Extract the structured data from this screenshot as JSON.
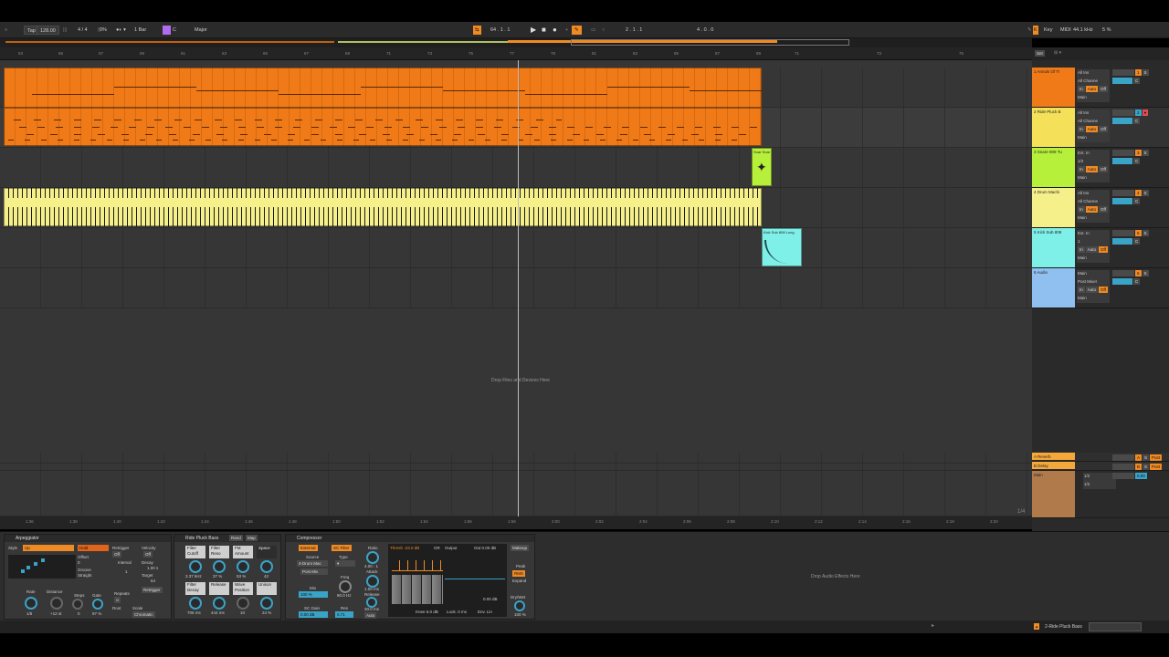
{
  "transport": {
    "tap": "Tap",
    "tempo": "128.00",
    "meter": "4 / 4",
    "swing": "0%",
    "quant": "1 Bar",
    "key": "C",
    "scale": "Major",
    "position": "64 . 1 . 1",
    "loop_start": "2 . 1 . 1",
    "loop_len": "4 . 0 . 0",
    "key_btn": "Key",
    "midi_btn": "MIDI",
    "sample_rate": "44.1 kHz",
    "cpu": "5 %"
  },
  "ruler_bars": [
    "53",
    "55",
    "57",
    "59",
    "61",
    "63",
    "65",
    "67",
    "69",
    "71",
    "73",
    "75",
    "77",
    "79",
    "81",
    "83",
    "85",
    "87",
    "89",
    "71",
    "73",
    "75"
  ],
  "timeline_ticks": [
    "1:36",
    "1:38",
    "1:40",
    "1:42",
    "1:44",
    "1:46",
    "1:48",
    "1:50",
    "1:52",
    "1:54",
    "1:56",
    "1:58",
    "2:00",
    "2:02",
    "2:04",
    "2:06",
    "2:08",
    "2:10",
    "2:12",
    "2:14",
    "2:16",
    "2:18",
    "2:20"
  ],
  "clips": {
    "snare_label": "Snar Snar",
    "kick_label": "Kick Sub 808 Long"
  },
  "arrangement": {
    "drop_text": "Drop Files and Devices Here",
    "page_counter": "1/4"
  },
  "tracks": [
    {
      "name": "1 Annuls Of Ti",
      "in": "All Ins",
      "ch": "All Channe",
      "mon_in": "In",
      "mon_auto": "Auto",
      "mon_off": "Off",
      "out": "Main",
      "color": "#f07a18",
      "num": "1"
    },
    {
      "name": "2 Ride Pluck B",
      "in": "All Ins",
      "ch": "All Channe",
      "mon_in": "In",
      "mon_auto": "Auto",
      "mon_off": "Off",
      "out": "Main",
      "color": "#f5e05a",
      "num": "2"
    },
    {
      "name": "3 Snare 909 Tu",
      "in": "Ext. In",
      "ch": "1/2",
      "mon_in": "In",
      "mon_auto": "Auto",
      "mon_off": "Off",
      "out": "Main",
      "color": "#b7f03a",
      "num": "3"
    },
    {
      "name": "4 Drum Machi",
      "in": "All Ins",
      "ch": "All Channe",
      "mon_in": "In",
      "mon_auto": "Auto",
      "mon_off": "Off",
      "out": "Main",
      "color": "#f5f08a",
      "num": "4"
    },
    {
      "name": "5 Kick Sub 808",
      "in": "Ext. In",
      "ch": "1",
      "mon_in": "In",
      "mon_auto": "Auto",
      "mon_off": "Off",
      "out": "Main",
      "color": "#7ff0e8",
      "num": "5"
    },
    {
      "name": "6 Audio",
      "in": "Main",
      "ch": "Post Mixer",
      "mon_in": "In",
      "mon_auto": "Auto",
      "mon_off": "Off",
      "out": "Main",
      "color": "#8fc0f0",
      "num": "6"
    }
  ],
  "returns": [
    {
      "name": "A Reverb",
      "letter": "A"
    },
    {
      "name": "B Delay",
      "letter": "B"
    }
  ],
  "master": {
    "name": "Main",
    "out1": "1/2",
    "out2": "1/2",
    "vol": "0.00"
  },
  "mixer_header": {
    "set": "Set"
  },
  "arpeggiator": {
    "title": "Arpeggiator",
    "style_label": "Style",
    "style": "Up",
    "hold": "Hold",
    "offset_label": "Offset",
    "offset": "0",
    "groove_label": "Groove",
    "groove": "Straight",
    "retrig_label": "Retrigger",
    "retrig": "Off",
    "interval_label": "Interval",
    "interval": "1",
    "repeats_label": "Repeats",
    "repeats": "∞",
    "root_label": "Root",
    "scale_label": "Scale",
    "scale": "Chromatic",
    "velocity_label": "Velocity",
    "velocity": "Off",
    "decay_label": "Decay",
    "decay": "1.00 s",
    "target_label": "Target",
    "target": "64",
    "retrigger_btn": "Retrigger",
    "rate_label": "Rate",
    "rate": "1/8",
    "distance_label": "Distance",
    "distance": "+12 st",
    "steps_label": "Steps",
    "steps": "0",
    "gate_label": "Gate",
    "gate": "97 %"
  },
  "ride": {
    "title": "Ride Pluck Bass",
    "rand": "Rand",
    "map": "Map",
    "macros": [
      {
        "label": "Filter Cutoff",
        "val": "3.37 kHz"
      },
      {
        "label": "Filter Reso",
        "val": "37 %"
      },
      {
        "label": "FM Amount",
        "val": "53 %"
      },
      {
        "label": "Space",
        "val": "42"
      },
      {
        "label": "Filter Decay",
        "val": "706 ms"
      },
      {
        "label": "Release",
        "val": "444 ms"
      },
      {
        "label": "Wave Position",
        "val": "10"
      },
      {
        "label": "Unison",
        "val": "24 %"
      }
    ]
  },
  "compressor": {
    "title": "Compressor",
    "external": "External",
    "sc_filter": "SC Filter",
    "source_label": "Source",
    "source": "4-Drum Mac",
    "post_mix": "Post Mix",
    "type_label": "Type",
    "mix_label": "Mix",
    "mix": "100 %",
    "sc_gain_label": "SC Gain",
    "sc_gain": "0.00 dB",
    "freq_label": "Freq",
    "freq": "80.0 Hz",
    "res_label": "Res",
    "res": "0.71",
    "ratio_label": "Ratio",
    "ratio": "4.00 : 1",
    "attack_label": "Attack",
    "attack": "1.00 ms",
    "release_label": "Release",
    "release": "30.0 ms",
    "auto": "Auto",
    "thresh": "Thresh -23.0 dB",
    "gr": "GR",
    "output_label": "Output",
    "out": "Out 0.00 dB",
    "makeup": "Makeup",
    "knee": "Knee 6.0 dB",
    "look": "Look. 0 ms",
    "env": "Env. Lin",
    "gain_out": "0.00 dB",
    "peak": "Peak",
    "rms": "RMS",
    "expand": "Expand",
    "dry_wet_label": "Dry/Wet",
    "dry_wet": "100 %"
  },
  "audio_fx_drop": "Drop Audio Effects Here",
  "status": {
    "track": "2-Ride Pluck Bass"
  }
}
